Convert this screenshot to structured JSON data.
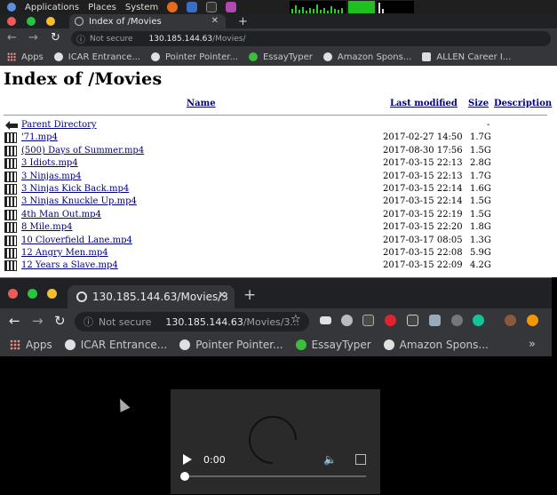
{
  "topbar": {
    "menus": [
      "Applications",
      "Places",
      "System"
    ]
  },
  "browser_back": {
    "tab_title": "Index of /Movies",
    "tab_close": "✕",
    "new_tab": "+",
    "url_prefix": "Not secure",
    "url_host": "130.185.144.63",
    "url_path": "/Movies/",
    "bookmarks": [
      "Apps",
      "ICAR Entrance...",
      "Pointer Pointer...",
      "EssayTyper",
      "Amazon Spons...",
      "ALLEN Career I..."
    ]
  },
  "listing": {
    "heading": "Index of /Movies",
    "columns": {
      "name": "Name",
      "modified": "Last modified",
      "size": "Size",
      "description": "Description"
    },
    "parent": {
      "label": "Parent Directory",
      "size": "-"
    },
    "rows": [
      {
        "name": "'71.mp4",
        "modified": "2017-02-27 14:50",
        "size": "1.7G"
      },
      {
        "name": "(500) Days of Summer.mp4",
        "modified": "2017-08-30 17:56",
        "size": "1.5G"
      },
      {
        "name": "3 Idiots.mp4",
        "modified": "2017-03-15 22:13",
        "size": "2.8G"
      },
      {
        "name": "3 Ninjas.mp4",
        "modified": "2017-03-15 22:13",
        "size": "1.7G"
      },
      {
        "name": "3 Ninjas Kick Back.mp4",
        "modified": "2017-03-15 22:14",
        "size": "1.6G"
      },
      {
        "name": "3 Ninjas Knuckle Up.mp4",
        "modified": "2017-03-15 22:14",
        "size": "1.5G"
      },
      {
        "name": "4th Man Out.mp4",
        "modified": "2017-03-15 22:19",
        "size": "1.5G"
      },
      {
        "name": "8 Mile.mp4",
        "modified": "2017-03-15 22:20",
        "size": "1.8G"
      },
      {
        "name": "10 Cloverfield Lane.mp4",
        "modified": "2017-03-17 08:05",
        "size": "1.3G"
      },
      {
        "name": "12 Angry Men.mp4",
        "modified": "2017-03-15 22:08",
        "size": "5.9G"
      },
      {
        "name": "12 Years a Slave.mp4",
        "modified": "2017-03-15 22:09",
        "size": "4.2G"
      }
    ]
  },
  "browser_front": {
    "tab_title": "130.185.144.63/Movies/3",
    "tab_close": "✕",
    "new_tab": "+",
    "url_prefix": "Not secure",
    "url_host": "130.185.144.63",
    "url_path": "/Movies/3...",
    "bookmarks": [
      "Apps",
      "ICAR Entrance...",
      "Pointer Pointer...",
      "EssayTyper",
      "Amazon Spons..."
    ],
    "more_bookmarks": "»"
  },
  "player": {
    "time": "0:00",
    "progress": 0.0
  }
}
